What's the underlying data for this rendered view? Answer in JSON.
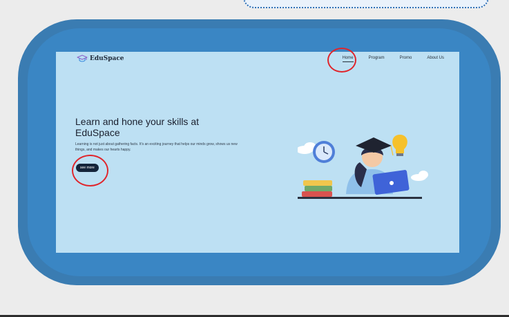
{
  "brand": {
    "name": "EduSpace",
    "icon": "graduation-cap-icon"
  },
  "nav": {
    "items": [
      {
        "label": "Home",
        "active": true
      },
      {
        "label": "Program",
        "active": false
      },
      {
        "label": "Promo",
        "active": false
      },
      {
        "label": "About Us",
        "active": false
      }
    ]
  },
  "hero": {
    "title": "Learn and hone your skills at EduSpace",
    "description": "Learning is not just about gathering facts. It's an exciting journey that helps our minds grow, shows us new things, and makes our hearts happy.",
    "cta_label": "see more"
  },
  "colors": {
    "frame": "#3a7cb2",
    "site_background": "#bde0f3",
    "button": "#14243a",
    "annotation": "#e0252b"
  }
}
